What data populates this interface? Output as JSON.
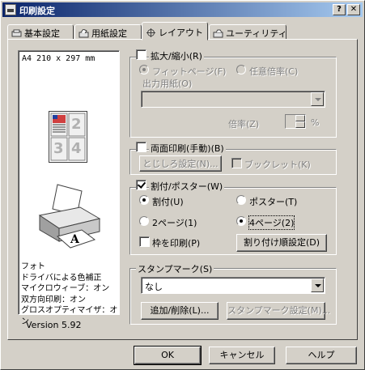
{
  "window": {
    "title": "印刷設定"
  },
  "tabs": [
    {
      "label": "基本設定",
      "active": false
    },
    {
      "label": "用紙設定",
      "active": false
    },
    {
      "label": "レイアウト",
      "active": true
    },
    {
      "label": "ユーティリティ",
      "active": false
    }
  ],
  "preview": {
    "paper_size": "A4 210 x 297 mm",
    "page_numbers": [
      "2",
      "3",
      "4"
    ],
    "print_mode": "フォト",
    "info_lines": [
      "ドライバによる色補正",
      "マイクロウィーブ：オン",
      "双方向印刷：オン",
      "グロスオプティマイザ：オン"
    ],
    "version": "Version 5.92"
  },
  "zoom": {
    "label": "拡大/縮小(R)",
    "checked": false,
    "fit_page": "フィットページ(F)",
    "custom_scale": "任意倍率(C)",
    "output_paper_label": "出力用紙(O)",
    "output_paper_value": "",
    "scale_label": "倍率(Z)",
    "scale_value": "",
    "scale_unit": "%"
  },
  "duplex": {
    "label": "両面印刷(手動)(B)",
    "checked": false,
    "margin_button": "とじしろ設定(N)...",
    "booklet_label": "ブックレット(K)"
  },
  "multipage": {
    "label": "割付/ポスター(W)",
    "checked": true,
    "nup_label": "割付(U)",
    "poster_label": "ポスター(T)",
    "two_pages": "2ページ(1)",
    "four_pages": "4ページ(2)",
    "print_border": "枠を印刷(P)",
    "order_button": "割り付け順設定(D)"
  },
  "stamp": {
    "label": "スタンプマーク(S)",
    "selected": "なし",
    "add_delete_button": "追加/削除(L)...",
    "settings_button": "スタンプマーク設定(M)..."
  },
  "footer": {
    "ok": "OK",
    "cancel": "キャンセル",
    "help": "ヘルプ"
  },
  "colors": {
    "face": "#d4d0c8",
    "title_start": "#0a246a",
    "title_end": "#a6caf0"
  }
}
